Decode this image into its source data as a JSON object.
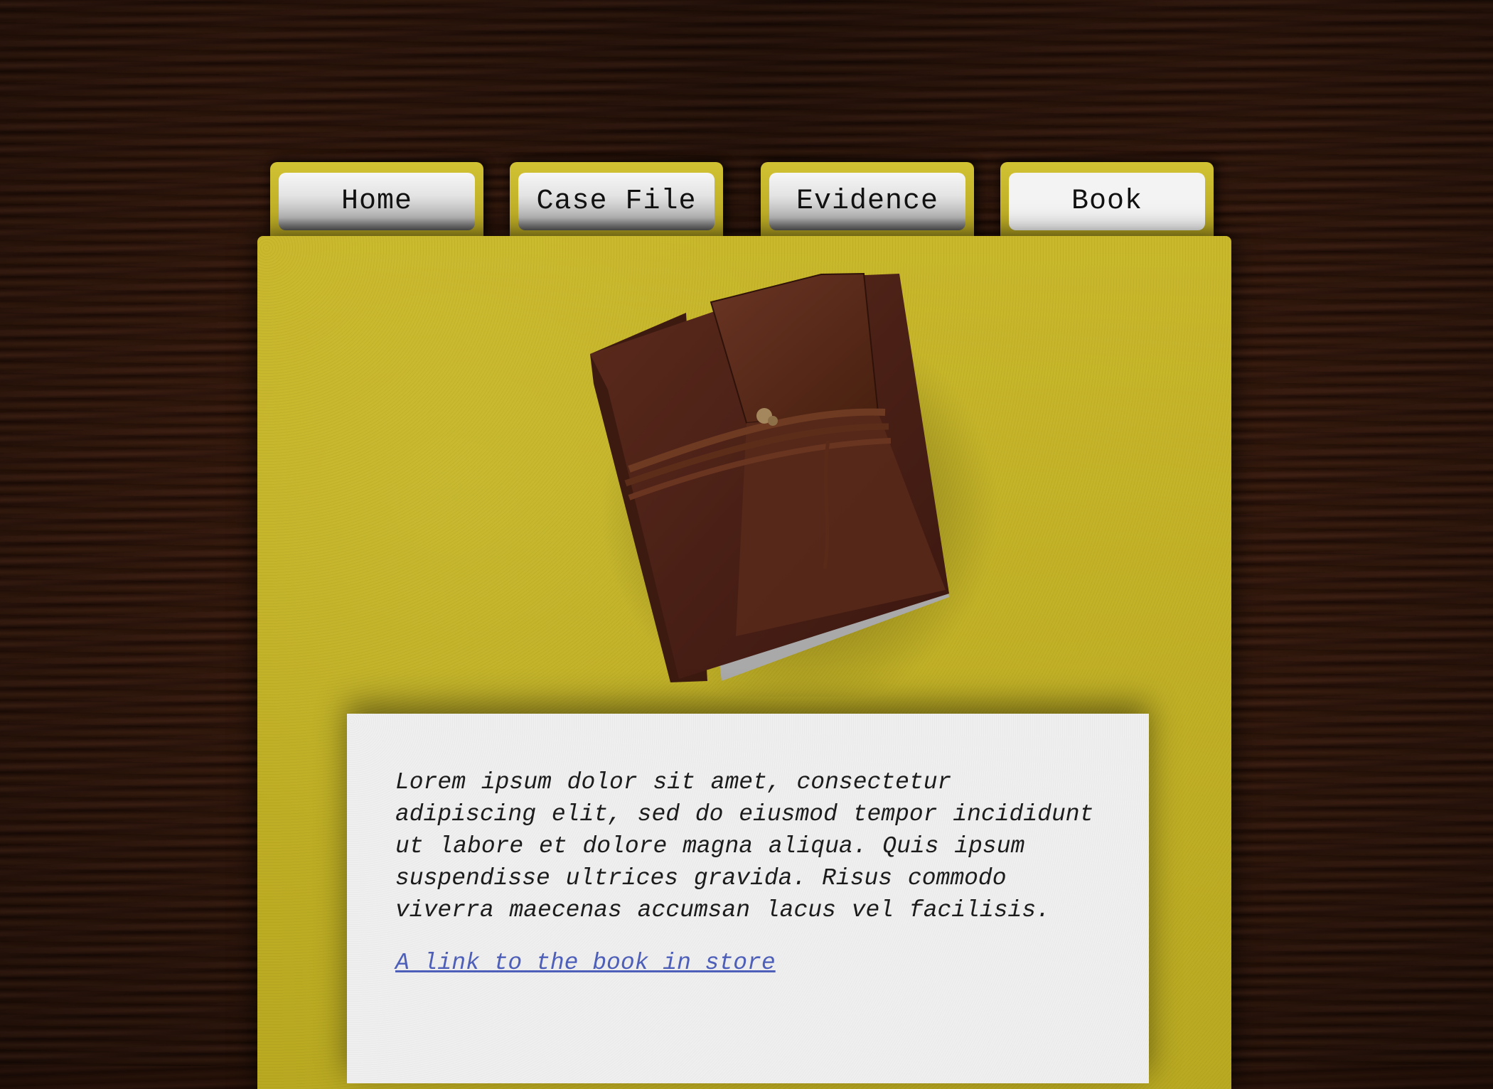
{
  "nav": {
    "tabs": [
      {
        "label": "Home",
        "active": false
      },
      {
        "label": "Case File",
        "active": false
      },
      {
        "label": "Evidence",
        "active": false
      },
      {
        "label": "Book",
        "active": true
      }
    ]
  },
  "main": {
    "image": {
      "icon": "leather-book-image"
    },
    "paper": {
      "body": "Lorem ipsum dolor sit amet, consectetur adipiscing elit, sed do eiusmod tempor incididunt ut labore et dolore magna aliqua. Quis ipsum suspendisse ultrices gravida. Risus commodo viverra maecenas accumsan lacus vel facilisis.",
      "link_label": "A link to the book in store"
    }
  },
  "colors": {
    "folder": "#c9b82c",
    "wood": "#3a1a0d",
    "paper": "#efefef",
    "link": "#4d5fb8"
  }
}
